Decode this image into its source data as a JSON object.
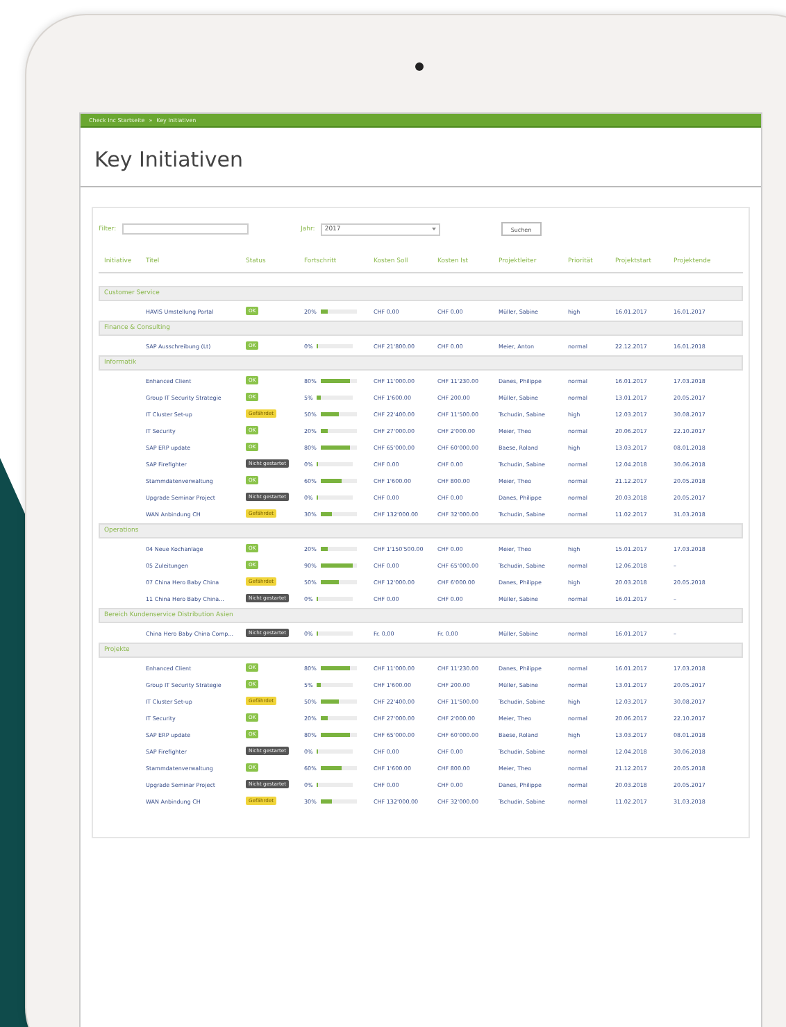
{
  "breadcrumb": [
    "Check Inc Startseite",
    "Key Initiativen"
  ],
  "breadcrumb_separator": "»",
  "page_title": "Key Initiativen",
  "filter": {
    "label": "Filter:"
  },
  "year": {
    "label": "Jahr:",
    "value": "2017"
  },
  "search_button": "Suchen",
  "columns": [
    "Initiative",
    "Titel",
    "Status",
    "Fortschritt",
    "Kosten Soll",
    "Kosten Ist",
    "Projektleiter",
    "Priorität",
    "Projektstart",
    "Projektende"
  ],
  "groups": [
    {
      "name": "Customer Service",
      "rows": [
        {
          "title": "HAVIS Umstellung Portal",
          "status": {
            "label": "OK",
            "kind": "ok"
          },
          "progress": "20%",
          "level": 0.2,
          "cost_plan": "CHF 0.00",
          "cost_actual": "CHF 0.00",
          "lead": "Müller, Sabine",
          "priority": "high",
          "start": "16.01.2017",
          "end": "16.01.2017"
        }
      ]
    },
    {
      "name": "Finance & Consulting",
      "rows": [
        {
          "title": "SAP Ausschreibung (Lt)",
          "status": {
            "label": "OK",
            "kind": "ok"
          },
          "progress": "0%",
          "level": 0,
          "cost_plan": "CHF 21'800.00",
          "cost_actual": "CHF 0.00",
          "lead": "Meier, Anton",
          "priority": "normal",
          "start": "22.12.2017",
          "end": "16.01.2018"
        }
      ]
    },
    {
      "name": "Informatik",
      "rows": [
        {
          "title": "Enhanced Client",
          "status": {
            "label": "OK",
            "kind": "ok"
          },
          "progress": "80%",
          "level": 0.8,
          "cost_plan": "CHF 11'000.00",
          "cost_actual": "CHF 11'230.00",
          "lead": "Danes, Philippe",
          "priority": "normal",
          "start": "16.01.2017",
          "end": "17.03.2018"
        },
        {
          "title": "Group IT Security Strategie",
          "status": {
            "label": "OK",
            "kind": "ok"
          },
          "progress": "5%",
          "level": 0.1,
          "cost_plan": "CHF 1'600.00",
          "cost_actual": "CHF 200.00",
          "lead": "Müller, Sabine",
          "priority": "normal",
          "start": "13.01.2017",
          "end": "20.05.2017"
        },
        {
          "title": "IT Cluster Set-up",
          "status": {
            "label": "Gefährdet",
            "kind": "warning"
          },
          "progress": "50%",
          "level": 0.5,
          "cost_plan": "CHF 22'400.00",
          "cost_actual": "CHF 11'500.00",
          "lead": "Tschudin, Sabine",
          "priority": "high",
          "start": "12.03.2017",
          "end": "30.08.2017"
        },
        {
          "title": "IT Security",
          "status": {
            "label": "OK",
            "kind": "ok"
          },
          "progress": "20%",
          "level": 0.2,
          "cost_plan": "CHF 27'000.00",
          "cost_actual": "CHF 2'000.00",
          "lead": "Meier, Theo",
          "priority": "normal",
          "start": "20.06.2017",
          "end": "22.10.2017"
        },
        {
          "title": "SAP ERP update",
          "status": {
            "label": "OK",
            "kind": "ok"
          },
          "progress": "80%",
          "level": 0.8,
          "cost_plan": "CHF 65'000.00",
          "cost_actual": "CHF 60'000.00",
          "lead": "Baese, Roland",
          "priority": "high",
          "start": "13.03.2017",
          "end": "08.01.2018"
        },
        {
          "title": "SAP Firefighter",
          "status": {
            "label": "Nicht gestartet",
            "kind": "not_started"
          },
          "progress": "0%",
          "level": 0,
          "cost_plan": "CHF 0.00",
          "cost_actual": "CHF 0.00",
          "lead": "Tschudin, Sabine",
          "priority": "normal",
          "start": "12.04.2018",
          "end": "30.06.2018"
        },
        {
          "title": "Stammdatenverwaltung",
          "status": {
            "label": "OK",
            "kind": "ok"
          },
          "progress": "60%",
          "level": 0.6,
          "cost_plan": "CHF 1'600.00",
          "cost_actual": "CHF 800.00",
          "lead": "Meier, Theo",
          "priority": "normal",
          "start": "21.12.2017",
          "end": "20.05.2018"
        },
        {
          "title": "Upgrade Seminar Project",
          "status": {
            "label": "Nicht gestartet",
            "kind": "not_started"
          },
          "progress": "0%",
          "level": 0,
          "cost_plan": "CHF 0.00",
          "cost_actual": "CHF 0.00",
          "lead": "Danes, Philippe",
          "priority": "normal",
          "start": "20.03.2018",
          "end": "20.05.2017"
        },
        {
          "title": "WAN Anbindung CH",
          "status": {
            "label": "Gefährdet",
            "kind": "warning"
          },
          "progress": "30%",
          "level": 0.3,
          "cost_plan": "CHF 132'000.00",
          "cost_actual": "CHF 32'000.00",
          "lead": "Tschudin, Sabine",
          "priority": "normal",
          "start": "11.02.2017",
          "end": "31.03.2018"
        }
      ]
    },
    {
      "name": "Operations",
      "rows": [
        {
          "title": "04 Neue Kochanlage",
          "status": {
            "label": "OK",
            "kind": "ok"
          },
          "progress": "20%",
          "level": 0.2,
          "cost_plan": "CHF 1'150'500.00",
          "cost_actual": "CHF 0.00",
          "lead": "Meier, Theo",
          "priority": "high",
          "start": "15.01.2017",
          "end": "17.03.2018"
        },
        {
          "title": "05 Zuleitungen",
          "status": {
            "label": "OK",
            "kind": "ok"
          },
          "progress": "90%",
          "level": 0.9,
          "cost_plan": "CHF 0.00",
          "cost_actual": "CHF 65'000.00",
          "lead": "Tschudin, Sabine",
          "priority": "normal",
          "start": "12.06.2018",
          "end": "–"
        },
        {
          "title": "07 China Hero Baby China",
          "status": {
            "label": "Gefährdet",
            "kind": "warning"
          },
          "progress": "50%",
          "level": 0.5,
          "cost_plan": "CHF 12'000.00",
          "cost_actual": "CHF 6'000.00",
          "lead": "Danes, Philippe",
          "priority": "high",
          "start": "20.03.2018",
          "end": "20.05.2018"
        },
        {
          "title": "11 China Hero Baby China...",
          "status": {
            "label": "Nicht gestartet",
            "kind": "not_started"
          },
          "progress": "0%",
          "level": 0,
          "cost_plan": "CHF 0.00",
          "cost_actual": "CHF 0.00",
          "lead": "Müller, Sabine",
          "priority": "normal",
          "start": "16.01.2017",
          "end": "–"
        }
      ]
    },
    {
      "name": "Bereich Kundenservice Distribution Asien",
      "rows": [
        {
          "title": "China Hero Baby China Comp...",
          "status": {
            "label": "Nicht gestartet",
            "kind": "not_started"
          },
          "progress": "0%",
          "level": 0,
          "cost_plan": "Fr. 0.00",
          "cost_actual": "Fr. 0.00",
          "lead": "Müller, Sabine",
          "priority": "normal",
          "start": "16.01.2017",
          "end": "–"
        }
      ]
    },
    {
      "name": "Projekte",
      "rows": [
        {
          "title": "Enhanced Client",
          "status": {
            "label": "OK",
            "kind": "ok"
          },
          "progress": "80%",
          "level": 0.8,
          "cost_plan": "CHF 11'000.00",
          "cost_actual": "CHF 11'230.00",
          "lead": "Danes, Philippe",
          "priority": "normal",
          "start": "16.01.2017",
          "end": "17.03.2018"
        },
        {
          "title": "Group IT Security Strategie",
          "status": {
            "label": "OK",
            "kind": "ok"
          },
          "progress": "5%",
          "level": 0.1,
          "cost_plan": "CHF 1'600.00",
          "cost_actual": "CHF 200.00",
          "lead": "Müller, Sabine",
          "priority": "normal",
          "start": "13.01.2017",
          "end": "20.05.2017"
        },
        {
          "title": "IT Cluster Set-up",
          "status": {
            "label": "Gefährdet",
            "kind": "warning"
          },
          "progress": "50%",
          "level": 0.5,
          "cost_plan": "CHF 22'400.00",
          "cost_actual": "CHF 11'500.00",
          "lead": "Tschudin, Sabine",
          "priority": "high",
          "start": "12.03.2017",
          "end": "30.08.2017"
        },
        {
          "title": "IT Security",
          "status": {
            "label": "OK",
            "kind": "ok"
          },
          "progress": "20%",
          "level": 0.2,
          "cost_plan": "CHF 27'000.00",
          "cost_actual": "CHF 2'000.00",
          "lead": "Meier, Theo",
          "priority": "normal",
          "start": "20.06.2017",
          "end": "22.10.2017"
        },
        {
          "title": "SAP ERP update",
          "status": {
            "label": "OK",
            "kind": "ok"
          },
          "progress": "80%",
          "level": 0.8,
          "cost_plan": "CHF 65'000.00",
          "cost_actual": "CHF 60'000.00",
          "lead": "Baese, Roland",
          "priority": "high",
          "start": "13.03.2017",
          "end": "08.01.2018"
        },
        {
          "title": "SAP Firefighter",
          "status": {
            "label": "Nicht gestartet",
            "kind": "not_started"
          },
          "progress": "0%",
          "level": 0,
          "cost_plan": "CHF 0.00",
          "cost_actual": "CHF 0.00",
          "lead": "Tschudin, Sabine",
          "priority": "normal",
          "start": "12.04.2018",
          "end": "30.06.2018"
        },
        {
          "title": "Stammdatenverwaltung",
          "status": {
            "label": "OK",
            "kind": "ok"
          },
          "progress": "60%",
          "level": 0.6,
          "cost_plan": "CHF 1'600.00",
          "cost_actual": "CHF 800.00",
          "lead": "Meier, Theo",
          "priority": "normal",
          "start": "21.12.2017",
          "end": "20.05.2018"
        },
        {
          "title": "Upgrade Seminar Project",
          "status": {
            "label": "Nicht gestartet",
            "kind": "not_started"
          },
          "progress": "0%",
          "level": 0,
          "cost_plan": "CHF 0.00",
          "cost_actual": "CHF 0.00",
          "lead": "Danes, Philippe",
          "priority": "normal",
          "start": "20.03.2018",
          "end": "20.05.2017"
        },
        {
          "title": "WAN Anbindung CH",
          "status": {
            "label": "Gefährdet",
            "kind": "warning"
          },
          "progress": "30%",
          "level": 0.3,
          "cost_plan": "CHF 132'000.00",
          "cost_actual": "CHF 32'000.00",
          "lead": "Tschudin, Sabine",
          "priority": "normal",
          "start": "11.02.2017",
          "end": "31.03.2018"
        }
      ]
    }
  ]
}
